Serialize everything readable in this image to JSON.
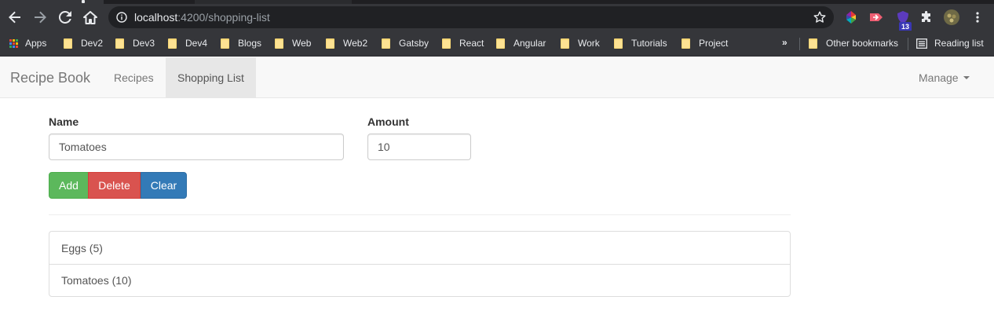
{
  "browser": {
    "url_host": "localhost",
    "url_path": ":4200/shopping-list",
    "extension_badge": "13",
    "bookmarks": [
      "Dev2",
      "Dev3",
      "Dev4",
      "Blogs",
      "Web",
      "Web2",
      "Gatsby",
      "React",
      "Angular",
      "Work",
      "Tutorials",
      "Project"
    ],
    "apps_label": "Apps",
    "overflow_label": "»",
    "other_bookmarks": "Other bookmarks",
    "reading_list": "Reading list"
  },
  "navbar": {
    "brand": "Recipe Book",
    "links": [
      "Recipes",
      "Shopping List"
    ],
    "active_link": "Shopping List",
    "manage": "Manage"
  },
  "form": {
    "name_label": "Name",
    "name_value": "Tomatoes",
    "amount_label": "Amount",
    "amount_value": "10",
    "add_label": "Add",
    "delete_label": "Delete",
    "clear_label": "Clear"
  },
  "shopping_list": [
    "Eggs (5)",
    "Tomatoes (10)"
  ],
  "colors": {
    "add": "#5cb85c",
    "delete": "#d9534f",
    "clear": "#337ab7"
  }
}
